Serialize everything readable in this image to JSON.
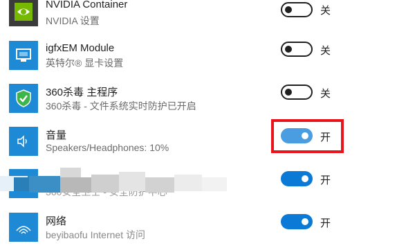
{
  "apps": [
    {
      "name": "NVIDIA Container",
      "description": "NVIDIA 设置",
      "state_label": "关",
      "toggle_on": false,
      "icon": "nvidia-icon"
    },
    {
      "name": "igfxEM Module",
      "description": "英特尔® 显卡设置",
      "state_label": "关",
      "toggle_on": false,
      "icon": "intel-graphics-icon"
    },
    {
      "name": "360杀毒 主程序",
      "description": "360杀毒 - 文件系统实时防护已开启",
      "state_label": "关",
      "toggle_on": false,
      "icon": "shield-check-icon"
    },
    {
      "name": "音量",
      "description": "Speakers/Headphones: 10%",
      "state_label": "开",
      "toggle_on": true,
      "icon": "speaker-icon"
    },
    {
      "name": "",
      "description": "360安全卫士 - 安全防护中心",
      "state_label": "开",
      "toggle_on": true,
      "icon": "360-safeguard-icon"
    },
    {
      "name": "网络",
      "description": "beyibaofu Internet 访问",
      "state_label": "开",
      "toggle_on": true,
      "icon": "wifi-icon"
    }
  ],
  "colors": {
    "accent": "#0a7ad6",
    "icon_tile": "#1e8ad6",
    "highlight_border": "#e8131b"
  }
}
